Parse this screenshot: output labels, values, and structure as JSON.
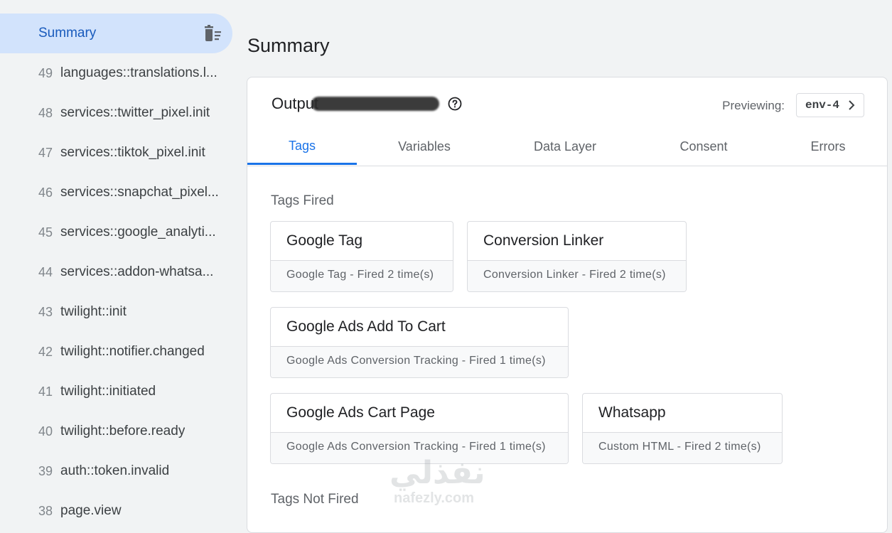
{
  "sidebar": {
    "summary_label": "Summary",
    "items": [
      {
        "num": "49",
        "label": "languages::translations.l..."
      },
      {
        "num": "48",
        "label": "services::twitter_pixel.init"
      },
      {
        "num": "47",
        "label": "services::tiktok_pixel.init"
      },
      {
        "num": "46",
        "label": "services::snapchat_pixel..."
      },
      {
        "num": "45",
        "label": "services::google_analyti..."
      },
      {
        "num": "44",
        "label": "services::addon-whatsa..."
      },
      {
        "num": "43",
        "label": "twilight::init"
      },
      {
        "num": "42",
        "label": "twilight::notifier.changed"
      },
      {
        "num": "41",
        "label": "twilight::initiated"
      },
      {
        "num": "40",
        "label": "twilight::before.ready"
      },
      {
        "num": "39",
        "label": "auth::token.invalid"
      },
      {
        "num": "38",
        "label": "page.view"
      }
    ]
  },
  "main": {
    "title": "Summary",
    "output_label": "Output",
    "previewing_label": "Previewing:",
    "env_label": "env-4",
    "tabs": [
      "Tags",
      "Variables",
      "Data Layer",
      "Consent",
      "Errors"
    ],
    "active_tab": "Tags",
    "tags_fired_label": "Tags Fired",
    "tags_not_fired_label": "Tags Not Fired",
    "tags_fired": [
      {
        "title": "Google Tag",
        "subtitle": "Google Tag - Fired 2 time(s)"
      },
      {
        "title": "Conversion Linker",
        "subtitle": "Conversion Linker - Fired 2 time(s)"
      },
      {
        "title": "Google Ads Add To Cart",
        "subtitle": "Google Ads Conversion Tracking - Fired 1 time(s)"
      },
      {
        "title": "Google Ads Cart Page",
        "subtitle": "Google Ads Conversion Tracking - Fired 1 time(s)"
      },
      {
        "title": "Whatsapp",
        "subtitle": "Custom HTML - Fired 2 time(s)"
      }
    ]
  },
  "watermark": {
    "arabic": "نفذلي",
    "latin": "nafezly.com"
  },
  "colors": {
    "accent": "#1a73e8",
    "sidebar_active_bg": "#d2e3fc",
    "page_bg": "#f1f3f4"
  },
  "icons": {
    "sidebar_action": "delete-sweep-icon",
    "help": "help-circle-icon",
    "env_chevron": "chevron-right-icon"
  }
}
